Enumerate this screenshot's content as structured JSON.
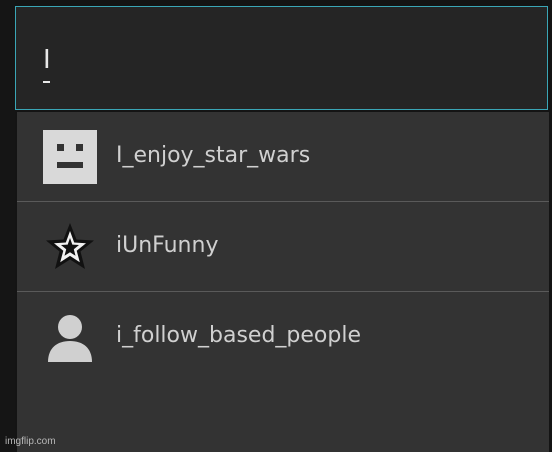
{
  "search": {
    "value": "I"
  },
  "suggestions": [
    {
      "label": "I_enjoy_star_wars",
      "icon": "robot-face-icon"
    },
    {
      "label": "iUnFunny",
      "icon": "star-icon"
    },
    {
      "label": "i_follow_based_people",
      "icon": "default-avatar-icon"
    }
  ],
  "watermark": "imgflip.com",
  "colors": {
    "input_border": "#3aa6b6",
    "dropdown_bg": "#333333",
    "input_bg": "#252525",
    "text": "#d0d0d0"
  }
}
